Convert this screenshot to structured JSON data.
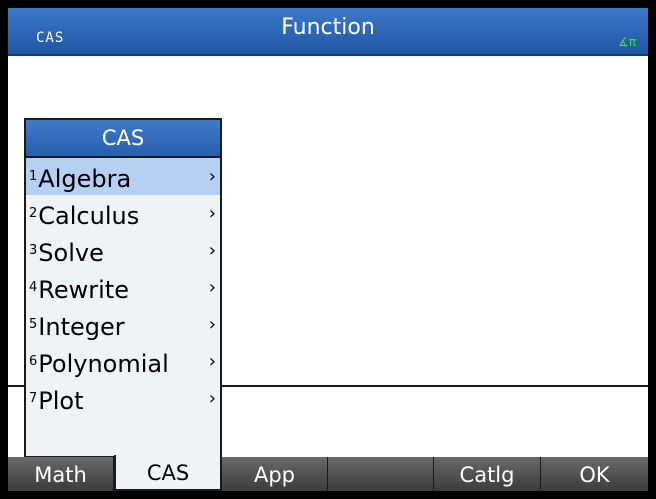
{
  "titlebar": {
    "mode": "CAS",
    "title": "Function",
    "angle_indicator": "∡π"
  },
  "menu": {
    "header": "CAS",
    "items": [
      {
        "num": "1",
        "label": "Algebra",
        "arrow": "›"
      },
      {
        "num": "2",
        "label": "Calculus",
        "arrow": "›"
      },
      {
        "num": "3",
        "label": "Solve",
        "arrow": "›"
      },
      {
        "num": "4",
        "label": "Rewrite",
        "arrow": "›"
      },
      {
        "num": "5",
        "label": "Integer",
        "arrow": "›"
      },
      {
        "num": "6",
        "label": "Polynomial",
        "arrow": "›"
      },
      {
        "num": "7",
        "label": "Plot",
        "arrow": "›"
      }
    ]
  },
  "softkeys": [
    "Math",
    "CAS",
    "App",
    "",
    "Catlg",
    "OK"
  ],
  "colors": {
    "title_bar": "#275fae",
    "selected_item": "#b6d0f4",
    "angle_indicator": "#44e04a"
  }
}
